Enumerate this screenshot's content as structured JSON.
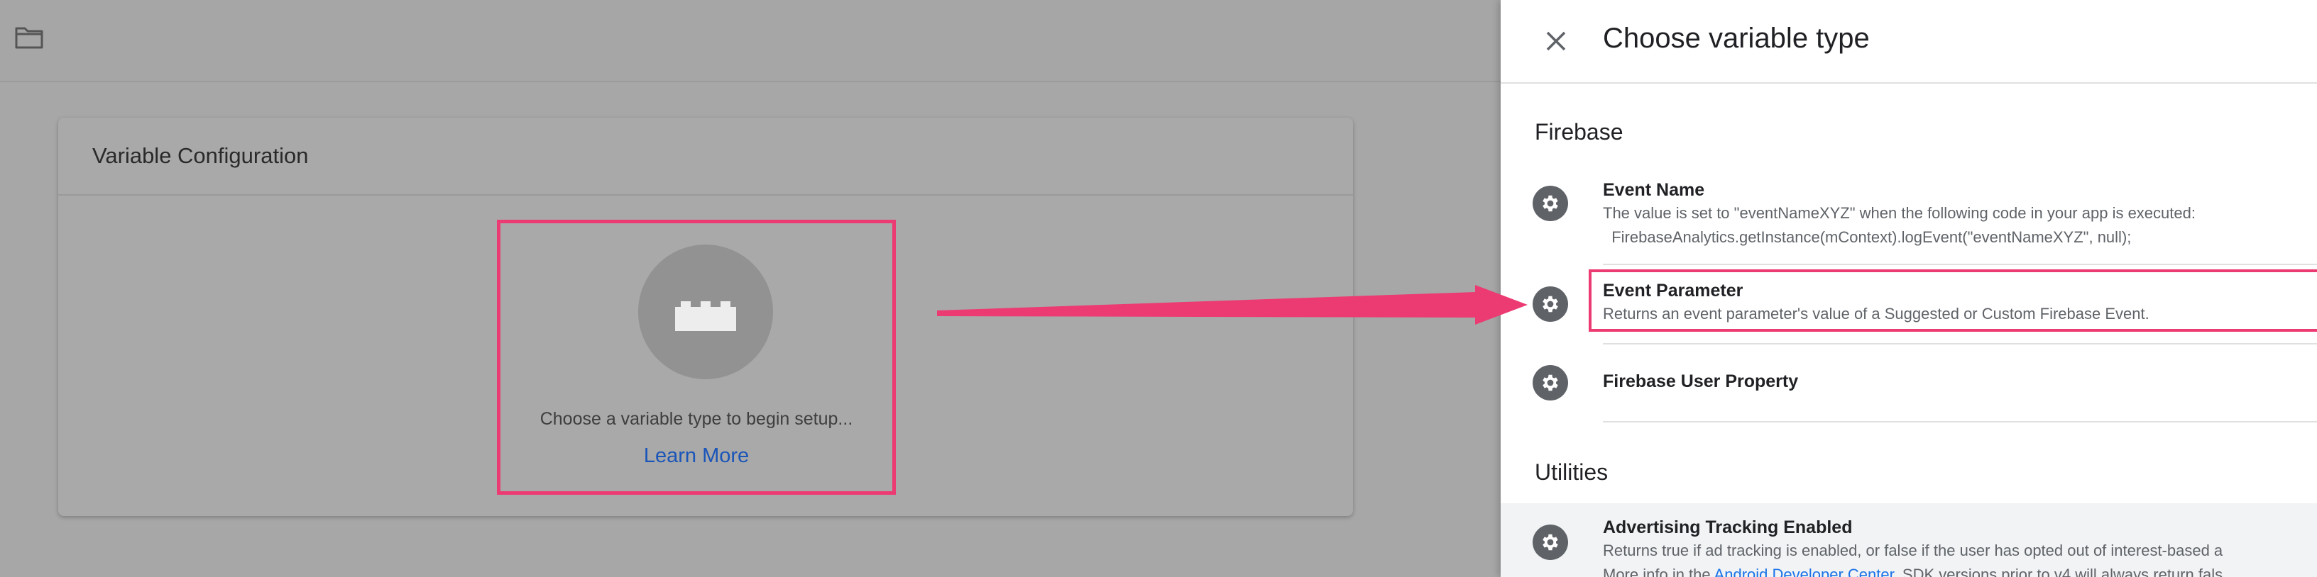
{
  "left_panel": {
    "folder_icon": "folder-icon",
    "card_title": "Variable Configuration",
    "placeholder_icon": "lego-brick-icon",
    "placeholder_text": "Choose a variable type to begin setup...",
    "learn_more": "Learn More"
  },
  "drawer": {
    "close_icon": "close-icon",
    "title": "Choose variable type",
    "sections": [
      {
        "title": "Firebase",
        "items": [
          {
            "name": "Event Name",
            "desc_lines": [
              "The value is set to \"eventNameXYZ\" when the following code in your app is executed:",
              "  FirebaseAnalytics.getInstance(mContext).logEvent(\"eventNameXYZ\", null);"
            ]
          },
          {
            "name": "Event Parameter",
            "desc_lines": [
              "Returns an event parameter's value of a Suggested or Custom Firebase Event."
            ]
          },
          {
            "name": "Firebase User Property",
            "desc_lines": []
          }
        ]
      },
      {
        "title": "Utilities",
        "items": [
          {
            "name": "Advertising Tracking Enabled",
            "desc_lines": [
              "Returns true if ad tracking is enabled, or false if the user has opted out of interest-based a"
            ],
            "desc_line2_prefix": "More info in the ",
            "desc_line2_link": "Android Developer Center",
            "desc_line2_suffix": ". SDK versions prior to v4 will always return fals"
          }
        ]
      }
    ],
    "item_icon": "gear-icon"
  },
  "colors": {
    "highlight": "#ec3a72",
    "link": "#1a55b8",
    "overlay": "#a7a7a7"
  }
}
